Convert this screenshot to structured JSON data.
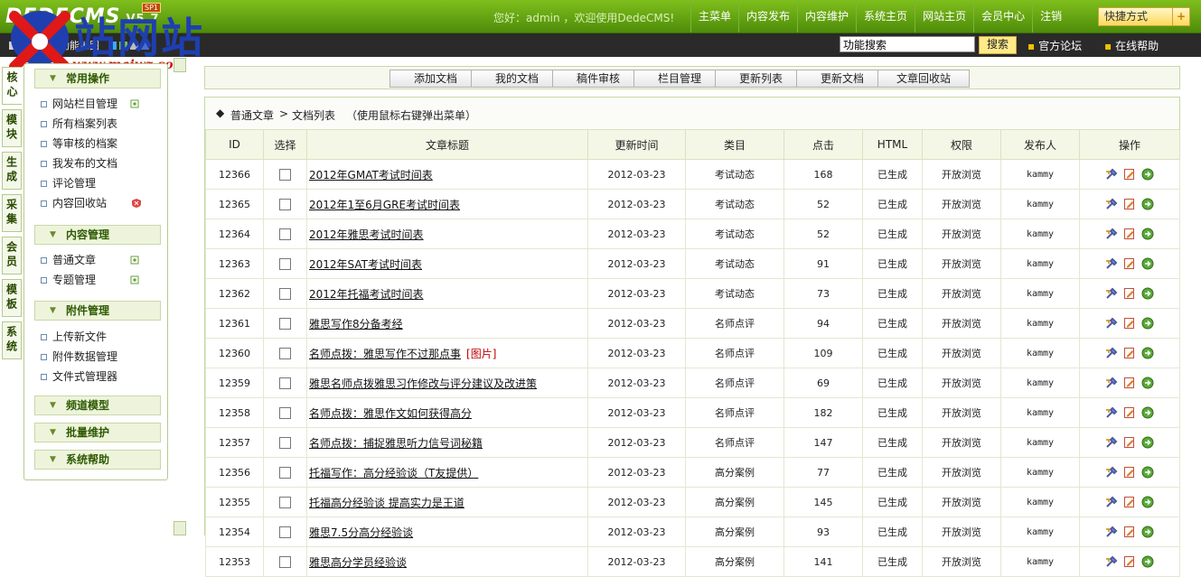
{
  "header": {
    "logo": "DEDECMS",
    "version": "V5.7",
    "badge": "SP1",
    "greeting": "您好：admin ，欢迎使用DedeCMS!",
    "nav": [
      "主菜单",
      "内容发布",
      "内容维护",
      "系统主页",
      "网站主页",
      "会员中心",
      "注销"
    ],
    "quick_label": "快捷方式",
    "quick_plus": "+"
  },
  "toolbar": {
    "left_items": [
      "收藏",
      "功能地图"
    ],
    "search_value": "功能搜索",
    "search_button": "搜索",
    "links": [
      "官方论坛",
      "在线帮助"
    ]
  },
  "watermark": {
    "title": "站网站",
    "url": "www.maiwz.com"
  },
  "vtabs": [
    "核心",
    "模块",
    "生成",
    "采集",
    "会员",
    "模板",
    "系统"
  ],
  "sidebar": {
    "sections": [
      {
        "title": "常用操作",
        "items": [
          "网站栏目管理",
          "所有档案列表",
          "等审核的档案",
          "我发布的文档",
          "评论管理",
          "内容回收站"
        ]
      },
      {
        "title": "内容管理",
        "items": [
          "普通文章",
          "专题管理"
        ]
      },
      {
        "title": "附件管理",
        "items": [
          "上传新文件",
          "附件数据管理",
          "文件式管理器"
        ]
      },
      {
        "title": "频道模型",
        "items": []
      },
      {
        "title": "批量维护",
        "items": []
      },
      {
        "title": "系统帮助",
        "items": []
      }
    ]
  },
  "main": {
    "buttons": [
      "添加文档",
      "我的文档",
      "稿件审核",
      "栏目管理",
      "更新列表",
      "更新文档",
      "文章回收站"
    ],
    "breadcrumb": {
      "marker": "◆",
      "level1": "普通文章",
      "separator": ">",
      "level2": "文档列表",
      "hint": "（使用鼠标右键弹出菜单）"
    },
    "columns": [
      "ID",
      "选择",
      "文章标题",
      "更新时间",
      "类目",
      "点击",
      "HTML",
      "权限",
      "发布人",
      "操作"
    ],
    "rows": [
      {
        "id": "12366",
        "title": "2012年GMAT考试时间表",
        "tag": "",
        "date": "2012-03-23",
        "cat": "考试动态",
        "clicks": "168",
        "html": "已生成",
        "perm": "开放浏览",
        "author": "kammy"
      },
      {
        "id": "12365",
        "title": "2012年1至6月GRE考试时间表",
        "tag": "",
        "date": "2012-03-23",
        "cat": "考试动态",
        "clicks": "52",
        "html": "已生成",
        "perm": "开放浏览",
        "author": "kammy"
      },
      {
        "id": "12364",
        "title": "2012年雅思考试时间表",
        "tag": "",
        "date": "2012-03-23",
        "cat": "考试动态",
        "clicks": "52",
        "html": "已生成",
        "perm": "开放浏览",
        "author": "kammy"
      },
      {
        "id": "12363",
        "title": "2012年SAT考试时间表",
        "tag": "",
        "date": "2012-03-23",
        "cat": "考试动态",
        "clicks": "91",
        "html": "已生成",
        "perm": "开放浏览",
        "author": "kammy"
      },
      {
        "id": "12362",
        "title": "2012年托福考试时间表",
        "tag": "",
        "date": "2012-03-23",
        "cat": "考试动态",
        "clicks": "73",
        "html": "已生成",
        "perm": "开放浏览",
        "author": "kammy"
      },
      {
        "id": "12361",
        "title": "雅思写作8分备考经",
        "tag": "",
        "date": "2012-03-23",
        "cat": "名师点评",
        "clicks": "94",
        "html": "已生成",
        "perm": "开放浏览",
        "author": "kammy"
      },
      {
        "id": "12360",
        "title": "名师点拨：雅思写作不过那点事",
        "tag": "[图片]",
        "date": "2012-03-23",
        "cat": "名师点评",
        "clicks": "109",
        "html": "已生成",
        "perm": "开放浏览",
        "author": "kammy"
      },
      {
        "id": "12359",
        "title": "雅思名师点拨雅思习作修改与评分建议及改进策",
        "tag": "",
        "date": "2012-03-23",
        "cat": "名师点评",
        "clicks": "69",
        "html": "已生成",
        "perm": "开放浏览",
        "author": "kammy"
      },
      {
        "id": "12358",
        "title": "名师点拨：雅思作文如何获得高分",
        "tag": "",
        "date": "2012-03-23",
        "cat": "名师点评",
        "clicks": "182",
        "html": "已生成",
        "perm": "开放浏览",
        "author": "kammy"
      },
      {
        "id": "12357",
        "title": "名师点拨：捕捉雅思听力信号词秘籍",
        "tag": "",
        "date": "2012-03-23",
        "cat": "名师点评",
        "clicks": "147",
        "html": "已生成",
        "perm": "开放浏览",
        "author": "kammy"
      },
      {
        "id": "12356",
        "title": "托福写作：高分经验谈（T友提供）",
        "tag": "",
        "date": "2012-03-23",
        "cat": "高分案例",
        "clicks": "77",
        "html": "已生成",
        "perm": "开放浏览",
        "author": "kammy"
      },
      {
        "id": "12355",
        "title": "托福高分经验谈 提高实力是王道",
        "tag": "",
        "date": "2012-03-23",
        "cat": "高分案例",
        "clicks": "145",
        "html": "已生成",
        "perm": "开放浏览",
        "author": "kammy"
      },
      {
        "id": "12354",
        "title": "雅思7.5分高分经验谈",
        "tag": "",
        "date": "2012-03-23",
        "cat": "高分案例",
        "clicks": "93",
        "html": "已生成",
        "perm": "开放浏览",
        "author": "kammy"
      },
      {
        "id": "12353",
        "title": "雅思高分学员经验谈",
        "tag": "",
        "date": "2012-03-23",
        "cat": "高分案例",
        "clicks": "141",
        "html": "已生成",
        "perm": "开放浏览",
        "author": "kammy"
      }
    ],
    "row_actions": [
      "edit-property-icon",
      "edit-doc-icon",
      "preview-icon"
    ]
  },
  "colors": {
    "header_green": "#6aaa14",
    "dark_bar": "#2a2a2a",
    "accent_yellow": "#ffd95a",
    "tag_red": "#c00000"
  }
}
